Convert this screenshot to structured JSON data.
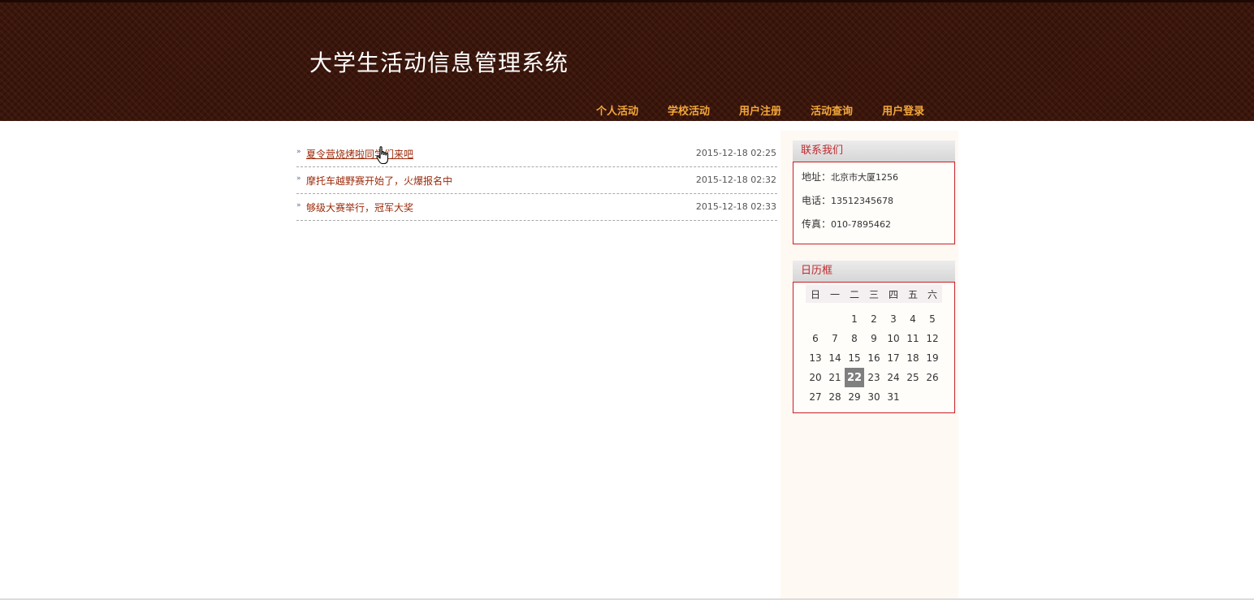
{
  "header": {
    "title": "大学生活动信息管理系统",
    "nav": [
      "个人活动",
      "学校活动",
      "用户注册",
      "活动查询",
      "用户登录"
    ]
  },
  "news": [
    {
      "title": "夏令营烧烤啦同学们来吧",
      "date": "2015-12-18 02:25"
    },
    {
      "title": "摩托车越野赛开始了，火爆报名中",
      "date": "2015-12-18 02:32"
    },
    {
      "title": "够级大赛举行，冠军大奖",
      "date": "2015-12-18 02:33"
    }
  ],
  "contact": {
    "title": "联系我们",
    "address_label": "地址：",
    "address": "北京市大厦1256",
    "phone_label": "电话：",
    "phone": "13512345678",
    "fax_label": "传真：",
    "fax": "010-7895462"
  },
  "calendar": {
    "title": "日历框",
    "weekdays": [
      "日",
      "一",
      "二",
      "三",
      "四",
      "五",
      "六"
    ],
    "weeks": [
      [
        "",
        "",
        "",
        "1",
        "2",
        "3",
        "4",
        "5"
      ],
      [
        "6",
        "7",
        "8",
        "9",
        "10",
        "11",
        "12"
      ],
      [
        "13",
        "14",
        "15",
        "16",
        "17",
        "18",
        "19"
      ],
      [
        "20",
        "21",
        "22",
        "23",
        "24",
        "25",
        "26"
      ],
      [
        "27",
        "28",
        "29",
        "30",
        "31",
        "",
        ""
      ]
    ],
    "today": "22"
  },
  "colors": {
    "header_bg": "#3b150a",
    "nav_text": "#f3a73a",
    "link": "#9b2a0a",
    "panel_title": "#c0282d",
    "panel_border": "#c61e28"
  },
  "icons": {
    "bullet": "double-chevron-icon",
    "cursor": "hand-pointer-icon"
  }
}
